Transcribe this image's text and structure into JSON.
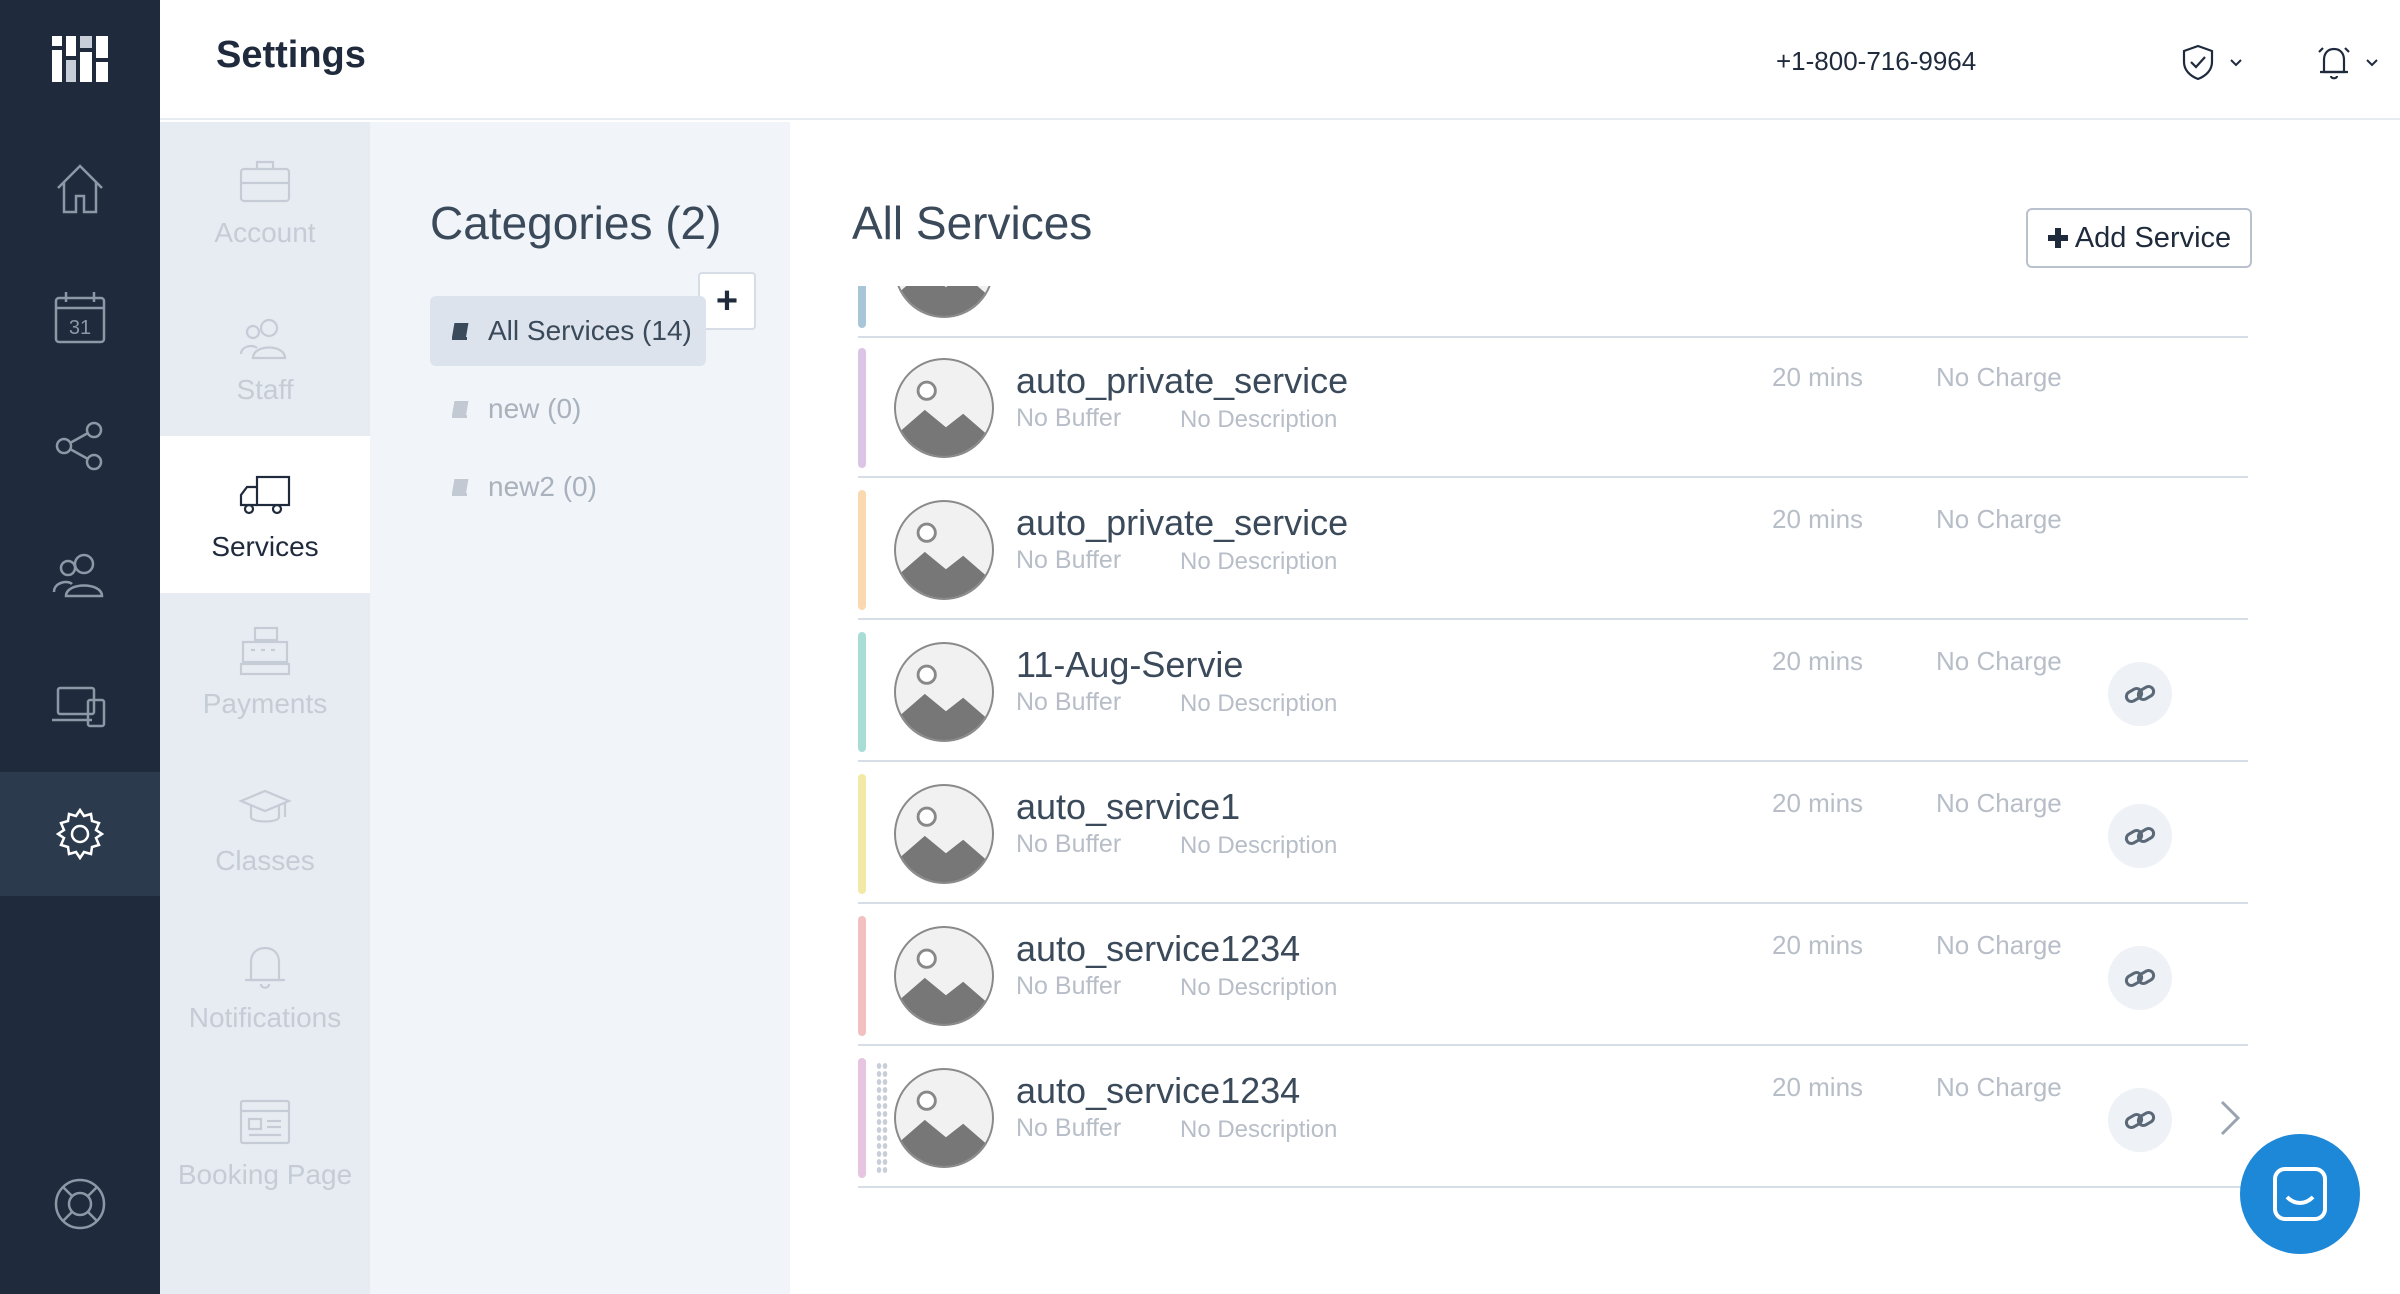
{
  "header": {
    "title": "Settings",
    "phone": "+1-800-716-9964"
  },
  "rail": {
    "items": [
      "home-icon",
      "calendar-icon",
      "share-icon",
      "customers-icon",
      "devices-icon",
      "settings-icon",
      "support-icon"
    ],
    "calendar_day": "31"
  },
  "subnav": {
    "items": [
      {
        "label": "Account",
        "icon": "briefcase-icon"
      },
      {
        "label": "Staff",
        "icon": "staff-icon"
      },
      {
        "label": "Services",
        "icon": "truck-icon"
      },
      {
        "label": "Payments",
        "icon": "register-icon"
      },
      {
        "label": "Classes",
        "icon": "graduation-cap-icon"
      },
      {
        "label": "Notifications",
        "icon": "bell-icon"
      },
      {
        "label": "Booking Page",
        "icon": "booking-page-icon"
      }
    ],
    "active": "Services"
  },
  "categories": {
    "heading": "Categories (2)",
    "add_label": "+",
    "items": [
      {
        "label": "All Services (14)"
      },
      {
        "label": "new (0)"
      },
      {
        "label": "new2 (0)"
      }
    ]
  },
  "services": {
    "heading": "All Services",
    "add_label": "Add Service",
    "rows": [
      {
        "name": "auto_private_service",
        "buffer": "No Buffer",
        "description": "No Description",
        "duration": "20 mins",
        "charge": "No Charge",
        "color": "#dcc4e6"
      },
      {
        "name": "auto_private_service",
        "buffer": "No Buffer",
        "description": "No Description",
        "duration": "20 mins",
        "charge": "No Charge",
        "color": "#fad9b0"
      },
      {
        "name": "11-Aug-Servie",
        "buffer": "No Buffer",
        "description": "No Description",
        "duration": "20 mins",
        "charge": "No Charge",
        "color": "#a8ddd6"
      },
      {
        "name": "auto_service1",
        "buffer": "No Buffer",
        "description": "No Description",
        "duration": "20 mins",
        "charge": "No Charge",
        "color": "#f3e9a6"
      },
      {
        "name": "auto_service1234",
        "buffer": "No Buffer",
        "description": "No Description",
        "duration": "20 mins",
        "charge": "No Charge",
        "color": "#f2c0c0"
      },
      {
        "name": "auto_service1234",
        "buffer": "No Buffer",
        "description": "No Description",
        "duration": "20 mins",
        "charge": "No Charge",
        "color": "#e7c4e0"
      }
    ],
    "partial_row_color": "#a9c6d9"
  },
  "colors": {
    "rail": "#1f2b3c",
    "accent": "#1e88d8"
  }
}
